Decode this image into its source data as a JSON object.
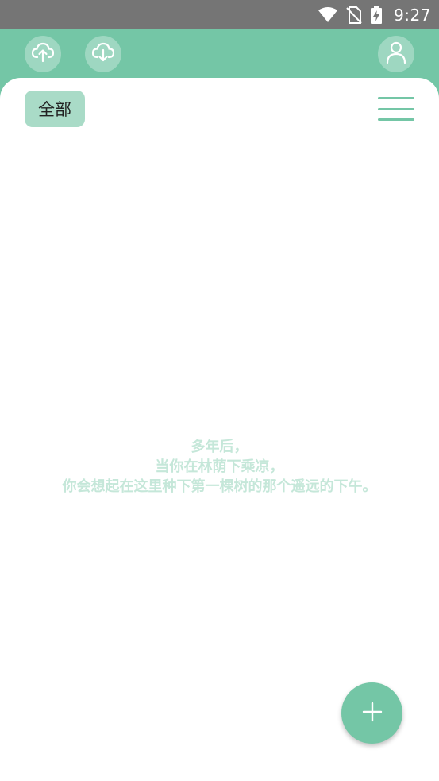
{
  "status_bar": {
    "time": "9:27",
    "icons": [
      "wifi-icon",
      "no-sim-icon",
      "battery-charging-icon"
    ]
  },
  "app_bar": {
    "buttons": [
      "cloud-upload-icon",
      "cloud-download-icon",
      "user-icon"
    ]
  },
  "filter": {
    "label": "全部"
  },
  "empty_state": {
    "lines": [
      "多年后，",
      "当你在林荫下乘凉，",
      "你会想起在这里种下第一棵树的那个遥远的下午。"
    ]
  },
  "fab": {
    "icon": "plus-icon"
  },
  "colors": {
    "accent": "#74c6a6",
    "chip_bg": "#a9dbc7",
    "empty_text": "#c5e7d9",
    "status_bar": "#757575"
  }
}
